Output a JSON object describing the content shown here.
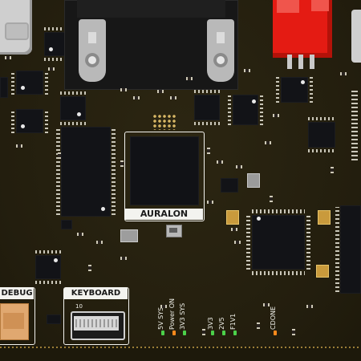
{
  "board": {
    "chip_label": "AURALON",
    "debug_label": "DEBUG",
    "keyboard_label": "KEYBOARD",
    "keyboard_pin_number": "10",
    "led_labels": [
      {
        "id": "5v-sys",
        "text": "5V SYS"
      },
      {
        "id": "power-on",
        "text": "Power ON"
      },
      {
        "id": "3v3-sys",
        "text": "3V3 SYS"
      },
      {
        "id": "3v3",
        "text": "3V3"
      },
      {
        "id": "2v5",
        "text": "2V5"
      },
      {
        "id": "1v1",
        "text": "F1V1"
      },
      {
        "id": "cdone",
        "text": "CDONE"
      }
    ]
  },
  "colors": {
    "pcb": "#27220f",
    "silkscreen": "#f3f3ef",
    "chip": "#121317",
    "red_switch": "#e41b13",
    "gold": "#d2a94a",
    "led_green": "#4cd14a",
    "led_orange": "#ff8a1c"
  }
}
